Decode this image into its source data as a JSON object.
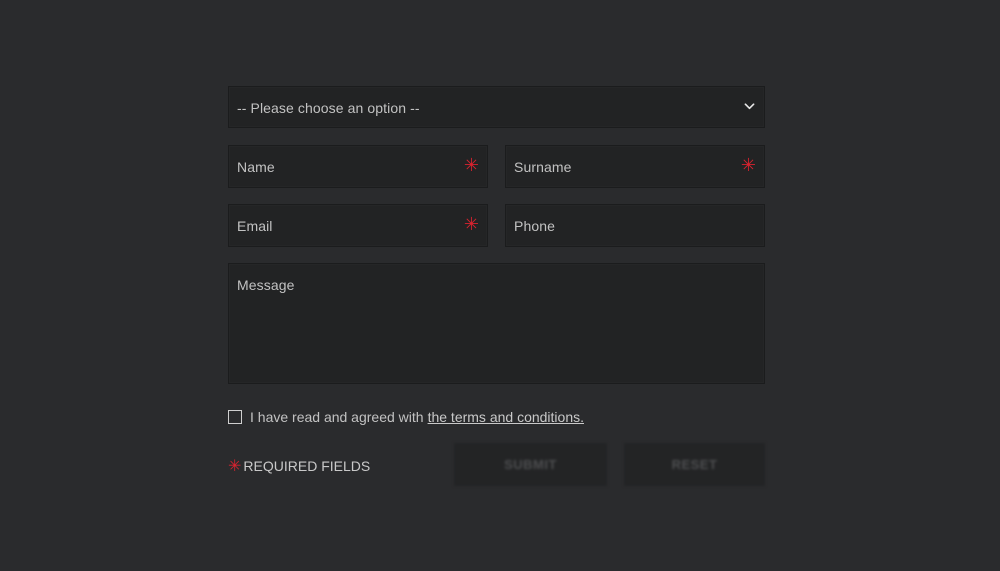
{
  "form": {
    "select": {
      "placeholder": "-- Please choose an option --",
      "icon": "chevron-down-icon"
    },
    "fields": {
      "name": {
        "label": "Name",
        "required": "✳"
      },
      "surname": {
        "label": "Surname",
        "required": "✳"
      },
      "email": {
        "label": "Email",
        "required": "✳"
      },
      "phone": {
        "label": "Phone"
      },
      "message": {
        "label": "Message"
      }
    },
    "agree": {
      "text": "I have read and agreed with",
      "link": "the terms and conditions."
    },
    "required_note": {
      "star": "✳",
      "text": "REQUIRED FIELDS"
    },
    "buttons": {
      "submit": "SUBMIT",
      "reset": "RESET"
    }
  },
  "colors": {
    "background": "#2a2b2d",
    "field_bg": "#222324",
    "required_star": "#d9232f",
    "text": "#c2c2c2"
  }
}
